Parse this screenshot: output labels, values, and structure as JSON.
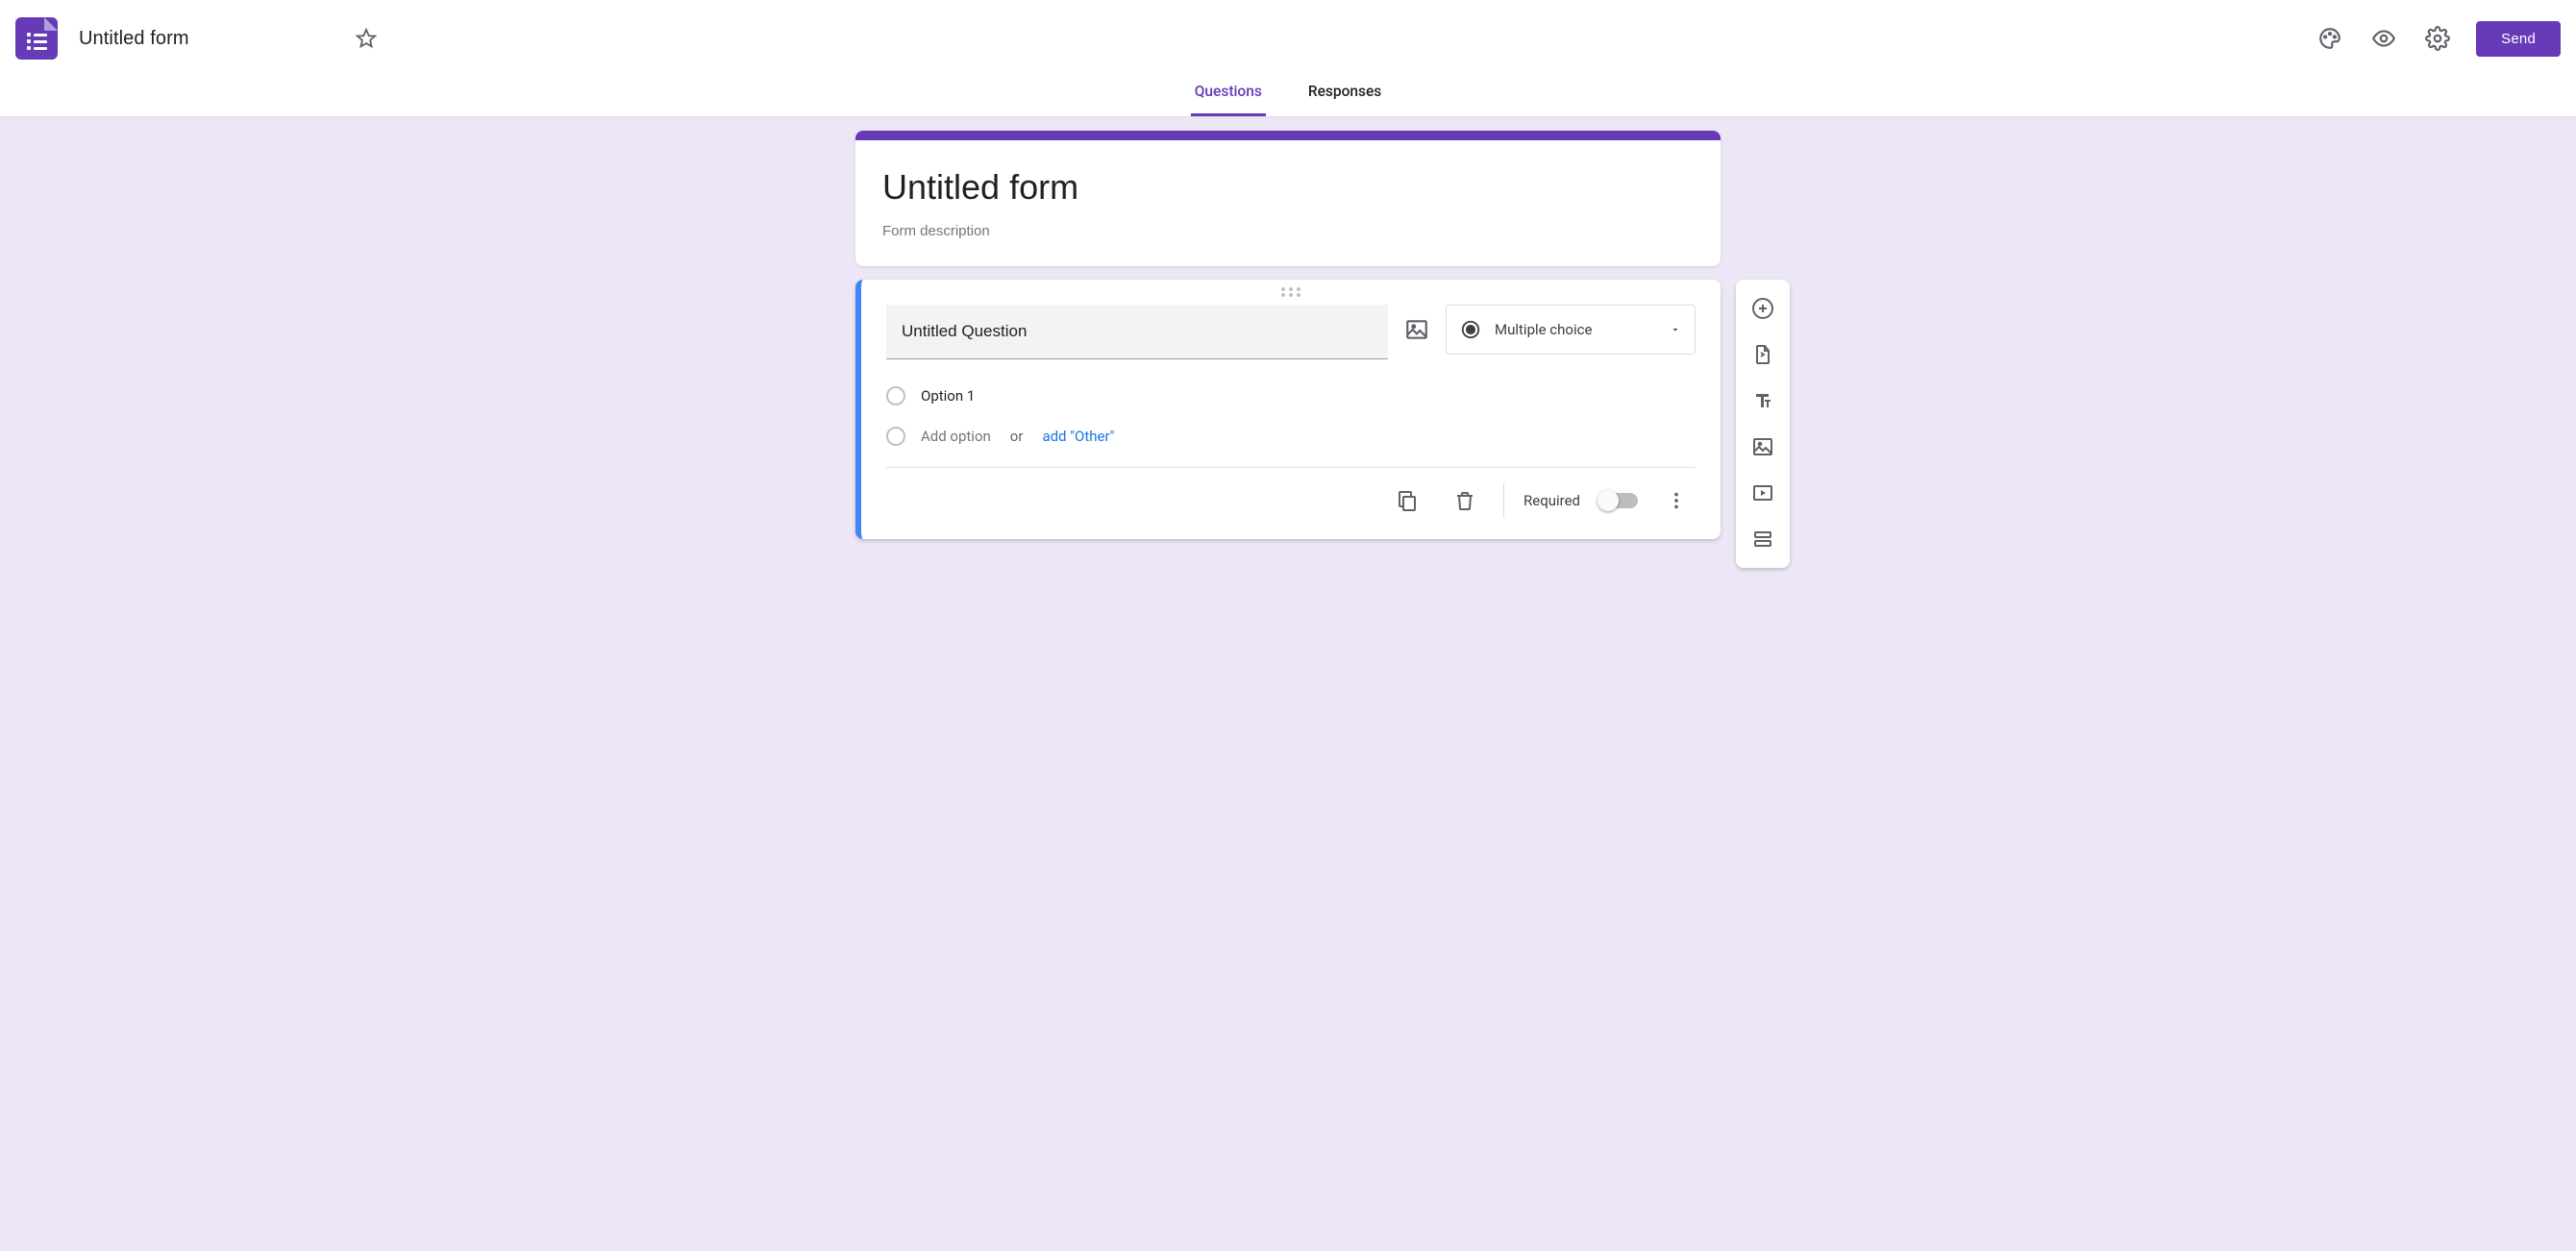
{
  "header": {
    "doc_title": "Untitled form",
    "send_label": "Send"
  },
  "tabs": {
    "questions": "Questions",
    "responses": "Responses",
    "active": "questions"
  },
  "form_header": {
    "title": "Untitled form",
    "description_placeholder": "Form description"
  },
  "question": {
    "title": "Untitled Question",
    "type_label": "Multiple choice",
    "options": [
      {
        "label": "Option 1"
      }
    ],
    "add_option_placeholder": "Add option",
    "or_text": "or",
    "add_other_link": "add \"Other\"",
    "required_label": "Required",
    "required": false
  },
  "icons": {
    "star": "star-icon",
    "palette": "palette-icon",
    "preview": "eye-icon",
    "settings": "gear-icon",
    "image": "image-icon",
    "radio": "radio-icon",
    "dropdown": "dropdown-arrow-icon",
    "copy": "copy-icon",
    "delete": "trash-icon",
    "more": "more-vert-icon",
    "add_question": "add-circle-icon",
    "import_questions": "import-questions-icon",
    "add_title": "text-title-icon",
    "add_image": "add-image-icon",
    "add_video": "add-video-icon",
    "add_section": "add-section-icon"
  },
  "colors": {
    "accent": "#673ab7",
    "selected_border": "#4285f4",
    "canvas_bg": "#ece6f6",
    "link": "#1a73e8"
  }
}
